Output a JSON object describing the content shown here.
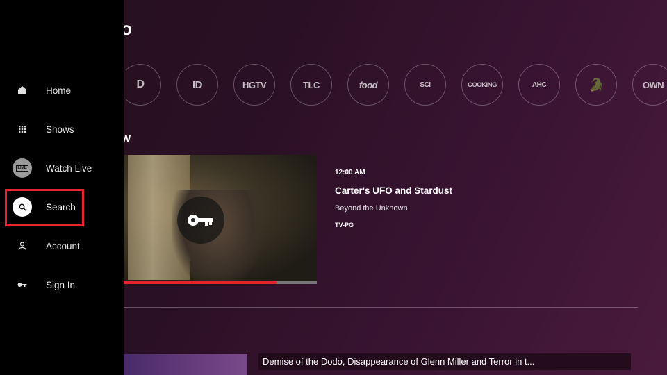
{
  "header": {
    "title_fragment": "o"
  },
  "networks": [
    {
      "name": "discovery-logo",
      "label": "D"
    },
    {
      "name": "id-logo",
      "label": "ID"
    },
    {
      "name": "hgtv-logo",
      "label": "HGTV"
    },
    {
      "name": "tlc-logo",
      "label": "TLC"
    },
    {
      "name": "food-logo",
      "label": "food"
    },
    {
      "name": "sci-logo",
      "label": "SCI"
    },
    {
      "name": "cooking-logo",
      "label": "COOKING"
    },
    {
      "name": "american-heroes-logo",
      "label": "AHC"
    },
    {
      "name": "animal-planet-logo",
      "label": "🐊"
    },
    {
      "name": "own-logo",
      "label": "OWN"
    }
  ],
  "section": {
    "heading_fragment": "w"
  },
  "featured": {
    "time": "12:00 AM",
    "title": "Carter's UFO and Stardust",
    "subtitle": "Beyond the Unknown",
    "rating": "TV-PG",
    "progress": 0.79
  },
  "bottom_row": {
    "description": "Demise of the Dodo, Disappearance of Glenn Miller and Terror in t..."
  },
  "sidebar": {
    "items": [
      {
        "label": "Home",
        "icon": "home-icon"
      },
      {
        "label": "Shows",
        "icon": "grid-icon"
      },
      {
        "label": "Watch Live",
        "icon": "live-icon",
        "badge": "LIVE"
      },
      {
        "label": "Search",
        "icon": "search-icon",
        "selected": true
      },
      {
        "label": "Account",
        "icon": "person-icon"
      },
      {
        "label": "Sign In",
        "icon": "key-icon"
      }
    ]
  },
  "colors": {
    "accent_red": "#e8232b",
    "sidebar_bg": "#000000"
  }
}
